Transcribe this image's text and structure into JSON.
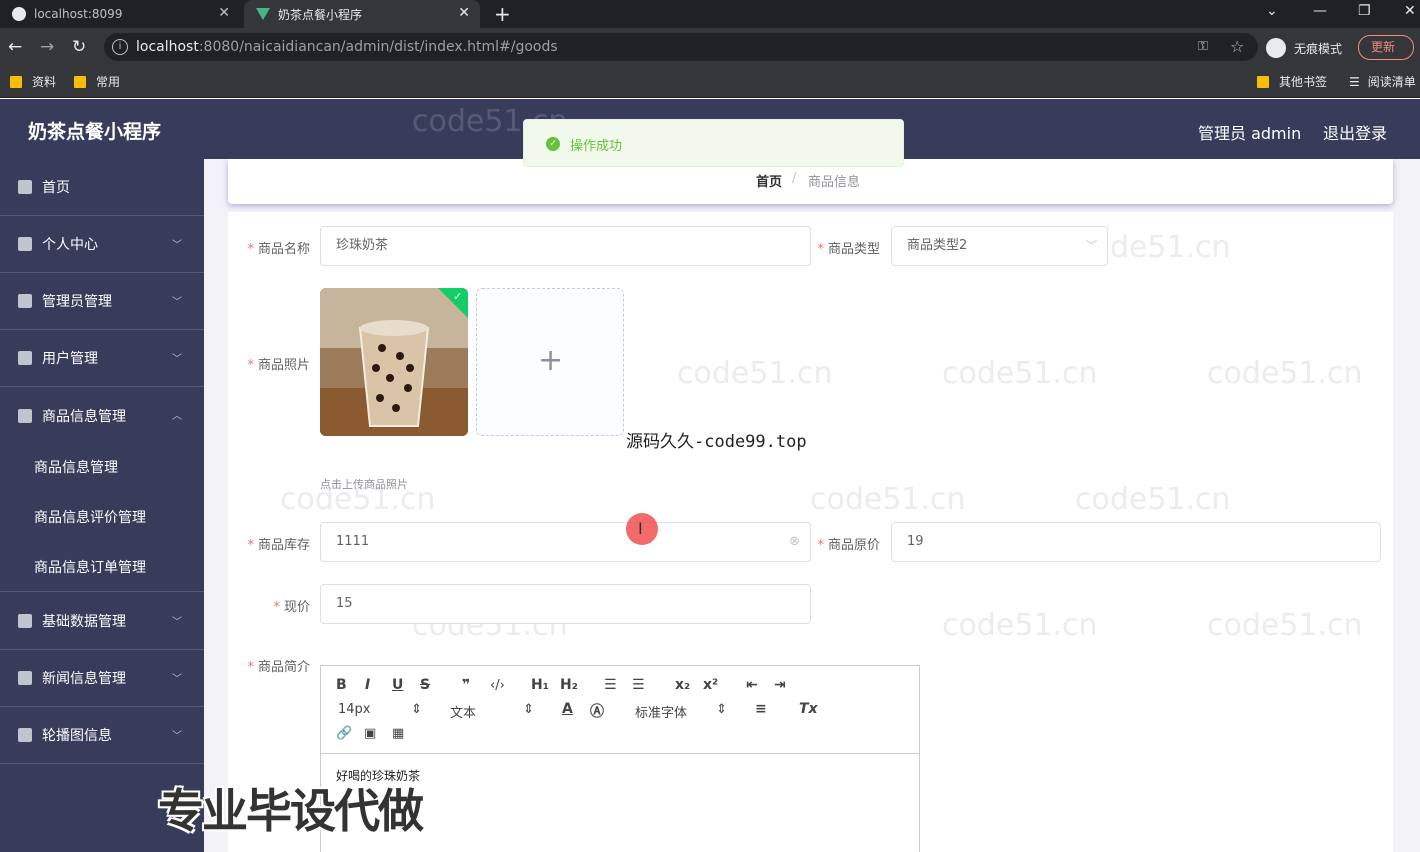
{
  "browser": {
    "tabs": [
      {
        "title": "localhost:8099"
      },
      {
        "title": "奶茶点餐小程序"
      }
    ],
    "url_host": "localhost",
    "url_rest": ":8080/naicaidiancan/admin/dist/index.html#/goods",
    "incognito_label": "无痕模式",
    "update_label": "更新",
    "bookmarks": [
      "资料",
      "常用"
    ],
    "bookmarks_right": [
      "其他书签",
      "阅读清单"
    ]
  },
  "header": {
    "app_title": "奶茶点餐小程序",
    "admin_label": "管理员 admin",
    "logout_label": "退出登录"
  },
  "toast": {
    "message": "操作成功"
  },
  "sidebar": {
    "items": [
      {
        "label": "首页",
        "icon": "home-icon"
      },
      {
        "label": "个人中心",
        "icon": "user-icon"
      },
      {
        "label": "管理员管理",
        "icon": "admin-icon"
      },
      {
        "label": "用户管理",
        "icon": "users-icon"
      },
      {
        "label": "商品信息管理",
        "icon": "goods-icon"
      },
      {
        "label": "基础数据管理",
        "icon": "data-icon"
      },
      {
        "label": "新闻信息管理",
        "icon": "news-icon"
      },
      {
        "label": "轮播图信息",
        "icon": "carousel-icon"
      }
    ],
    "subitems": [
      "商品信息管理",
      "商品信息评价管理",
      "商品信息订单管理"
    ]
  },
  "breadcrumb": {
    "home": "首页",
    "separator": "/",
    "current": "商品信息"
  },
  "form": {
    "name_label": "商品名称",
    "name_value": "珍珠奶茶",
    "type_label": "商品类型",
    "type_value": "商品类型2",
    "photo_label": "商品照片",
    "upload_tip": "点击上传商品照片",
    "stock_label": "商品库存",
    "stock_value": "1111",
    "orig_price_label": "商品原价",
    "orig_price_value": "19",
    "price_label": "现价",
    "price_value": "15",
    "intro_label": "商品简介",
    "intro_value": "好喝的珍珠奶茶"
  },
  "editor": {
    "size_select": "14px",
    "header_select": "文本",
    "font_select": "标准字体"
  },
  "overlay": {
    "watermark_source": "源码久久-code99.top",
    "promo_text": "专业毕设代做",
    "bg_watermark": "code51.cn"
  },
  "colors": {
    "sidebar_bg": "#383c5b",
    "success": "#67c23a",
    "required": "#f56c6c"
  }
}
